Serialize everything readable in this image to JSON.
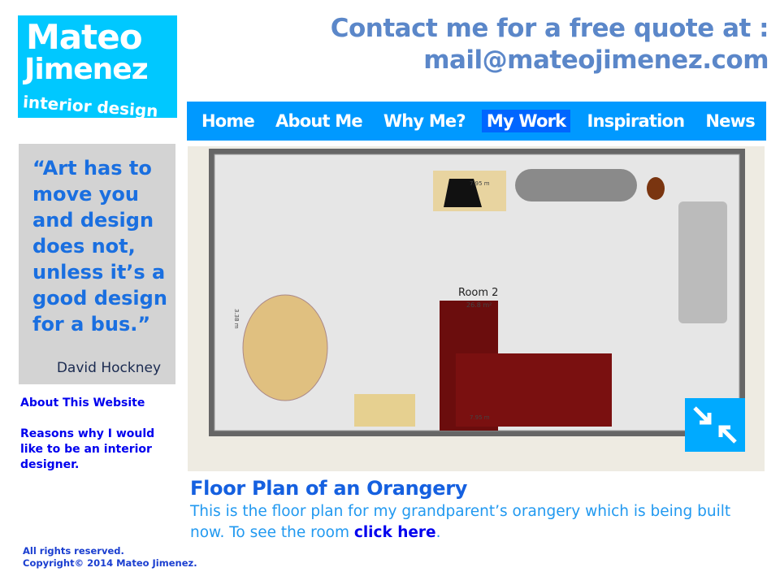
{
  "logo": {
    "line1": "Mateo",
    "line2": "Jimenez",
    "line3": "interior design"
  },
  "contact": {
    "line1": "Contact me for a free quote at :",
    "line2": "mail@mateojimenez.com"
  },
  "nav": [
    {
      "label": "Home"
    },
    {
      "label": "About Me"
    },
    {
      "label": "Why Me?"
    },
    {
      "label": "My Work",
      "active": true
    },
    {
      "label": "Inspiration"
    },
    {
      "label": "News"
    }
  ],
  "quote": {
    "text": "“Art has to move you and design does not, unless it’s a good design for a bus.”",
    "author": "David Hockney"
  },
  "sidebar_links": [
    {
      "label": "About This Website"
    },
    {
      "label": "Reasons why I would like to be an interior designer."
    }
  ],
  "floorplan": {
    "room": "Room 2",
    "area": "26.8 m²",
    "width_top": "7.95 m",
    "width_bottom": "7.95 m",
    "height": "3.38 m"
  },
  "caption": {
    "title": "Floor Plan of an Orangery",
    "text": "This is the floor plan for my grandparent’s  orangery which is being built now. To see the room ",
    "link": "click here",
    "end": "."
  },
  "footer": {
    "line1": "All rights reserved.",
    "line2": "Copyright© 2014 Mateo Jimenez."
  }
}
